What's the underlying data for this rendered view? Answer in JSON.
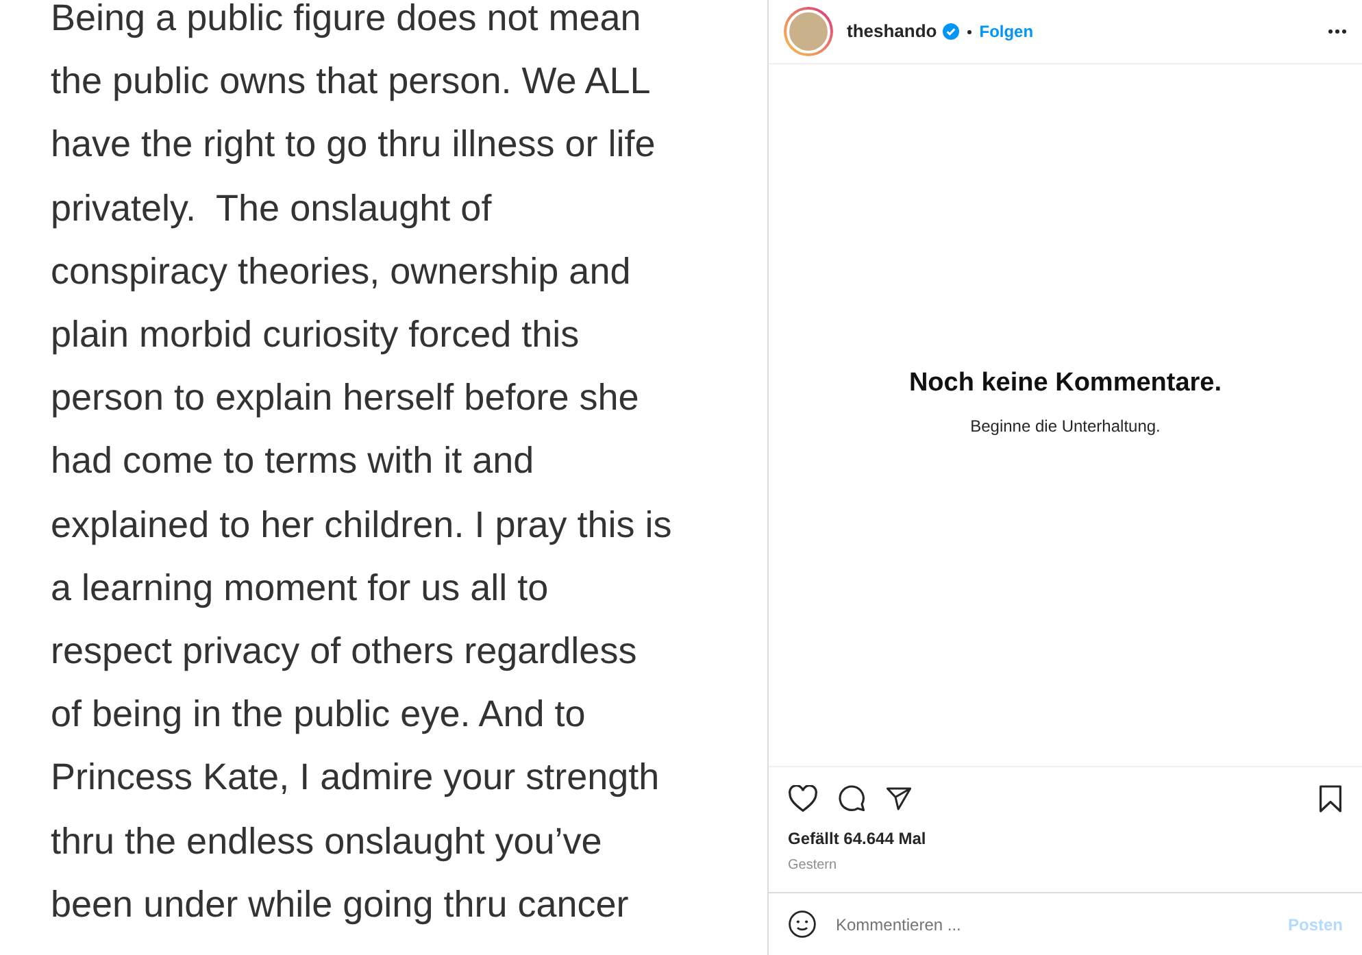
{
  "post_image": {
    "lines": [
      "Being a public figure does not mean",
      "the public owns that person. We ALL",
      "have the right to go thru illness or life",
      "privately.  The onslaught of",
      "conspiracy theories, ownership and",
      "plain morbid curiosity forced this",
      "person to explain herself before she",
      "had come to terms with it and",
      "explained to her children. I pray this is",
      "a learning moment for us all to",
      "respect privacy of others regardless",
      "of being in the public eye. And to",
      "Princess Kate, I admire your strength",
      "thru the endless onslaught you’ve",
      "been under while going thru cancer"
    ]
  },
  "header": {
    "username": "theshando",
    "verified": true,
    "follow": "Folgen"
  },
  "comments": {
    "title": "Noch keine Kommentare.",
    "subtitle": "Beginne die Unterhaltung."
  },
  "actions": {
    "liked": false,
    "saved": false
  },
  "likes": "Gefällt 64.644 Mal",
  "date": "Gestern",
  "comment_box": {
    "placeholder": "Kommentieren ...",
    "post": "Posten",
    "post_disabled": true
  }
}
